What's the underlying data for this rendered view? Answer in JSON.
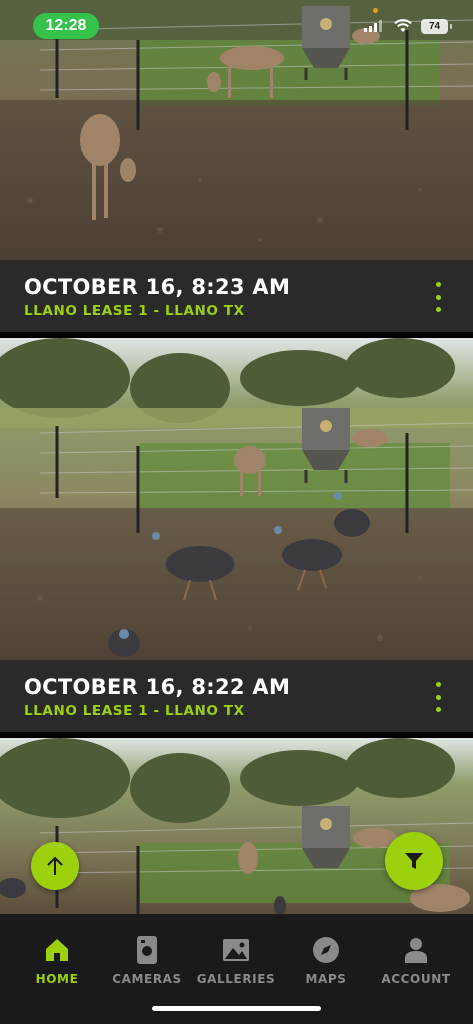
{
  "status_bar": {
    "time": "12:28",
    "battery": "74"
  },
  "feed": {
    "photos": [
      {
        "date": "OCTOBER 16, 8:23 AM",
        "location": "LLANO LEASE 1 - LLANO TX"
      },
      {
        "date": "OCTOBER 16, 8:22 AM",
        "location": "LLANO LEASE 1 - LLANO TX"
      }
    ]
  },
  "buttons": {
    "scroll_top": "arrow-up-icon",
    "filter": "filter-icon"
  },
  "nav": {
    "items": [
      {
        "label": "HOME",
        "icon": "home-icon",
        "active": true
      },
      {
        "label": "CAMERAS",
        "icon": "camera-icon",
        "active": false
      },
      {
        "label": "GALLERIES",
        "icon": "gallery-icon",
        "active": false
      },
      {
        "label": "MAPS",
        "icon": "compass-icon",
        "active": false
      },
      {
        "label": "ACCOUNT",
        "icon": "account-icon",
        "active": false
      }
    ]
  },
  "colors": {
    "accent": "#9ed10d",
    "caption_bg": "#2a2a2a",
    "nav_bg": "#1a1a1a",
    "status_time_bg": "#35c24a"
  }
}
